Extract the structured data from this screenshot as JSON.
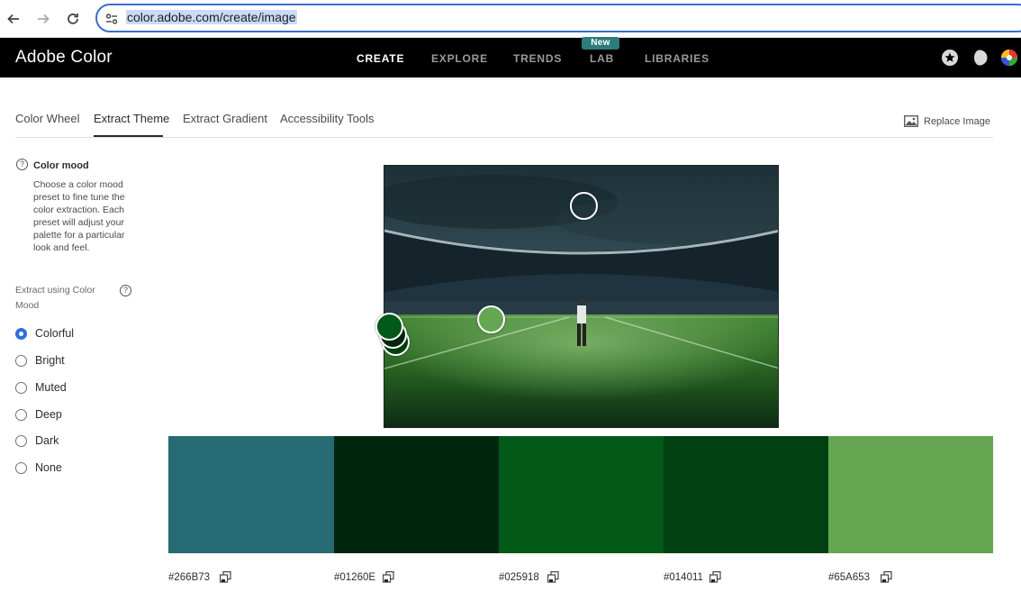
{
  "browser": {
    "url": "color.adobe.com/create/image"
  },
  "header": {
    "logo": "Adobe Color",
    "nav": [
      {
        "label": "CREATE",
        "active": true
      },
      {
        "label": "EXPLORE",
        "active": false
      },
      {
        "label": "TRENDS",
        "active": false
      },
      {
        "label": "LAB",
        "active": false
      },
      {
        "label": "LIBRARIES",
        "active": false
      }
    ],
    "lab_badge": "New",
    "accent_color": "#2c7d7a"
  },
  "tabs": [
    {
      "label": "Color Wheel",
      "active": false
    },
    {
      "label": "Extract Theme",
      "active": true
    },
    {
      "label": "Extract Gradient",
      "active": false
    },
    {
      "label": "Accessibility Tools",
      "active": false
    }
  ],
  "replace_image_label": "Replace Image",
  "sidebar": {
    "mood_title": "Color mood",
    "mood_description": "Choose a color mood preset to fine tune the color extraction. Each preset will adjust your palette for a particular look and feel.",
    "extract_label": "Extract using Color Mood",
    "options": [
      {
        "label": "Colorful",
        "selected": true
      },
      {
        "label": "Bright",
        "selected": false
      },
      {
        "label": "Muted",
        "selected": false
      },
      {
        "label": "Deep",
        "selected": false
      },
      {
        "label": "Dark",
        "selected": false
      },
      {
        "label": "None",
        "selected": false
      }
    ]
  },
  "swatches": [
    {
      "hex": "#266B73"
    },
    {
      "hex": "#01260E"
    },
    {
      "hex": "#025918"
    },
    {
      "hex": "#014011"
    },
    {
      "hex": "#65A653"
    }
  ]
}
